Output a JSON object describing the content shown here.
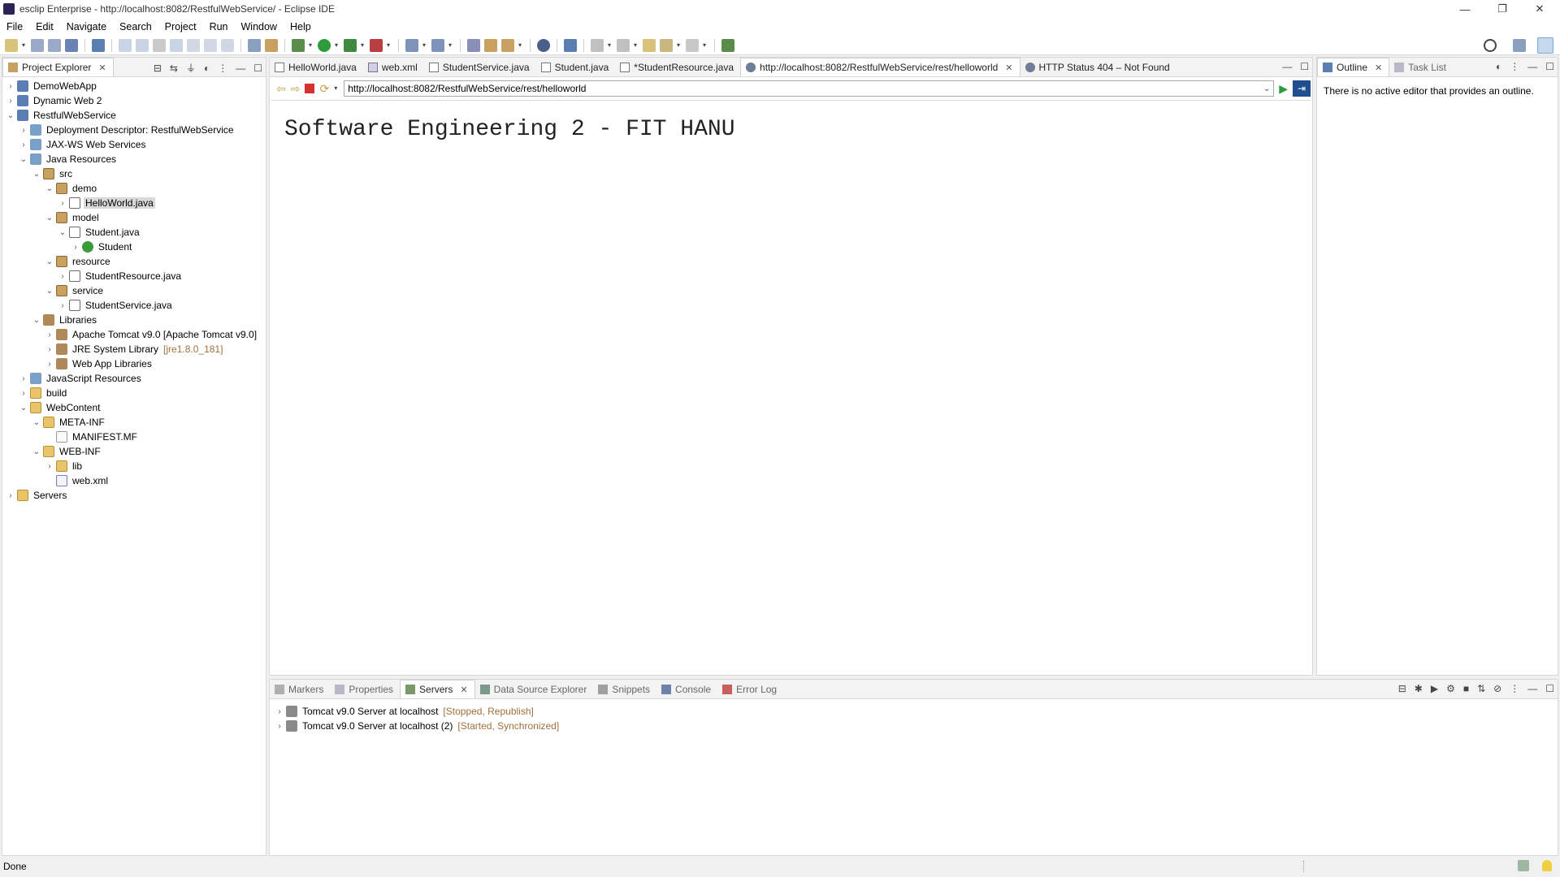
{
  "window": {
    "title": "esclip Enterprise - http://localhost:8082/RestfulWebService/ - Eclipse IDE",
    "controls": [
      "—",
      "❐",
      "✕"
    ]
  },
  "menu": [
    "File",
    "Edit",
    "Navigate",
    "Search",
    "Project",
    "Run",
    "Window",
    "Help"
  ],
  "project_explorer": {
    "tab_label": "Project Explorer",
    "tree": [
      {
        "label": "DemoWebApp",
        "depth": 0,
        "arrow": "›",
        "icon": "project"
      },
      {
        "label": "Dynamic Web 2",
        "depth": 0,
        "arrow": "›",
        "icon": "project"
      },
      {
        "label": "RestfulWebService",
        "depth": 0,
        "arrow": "⌄",
        "icon": "project"
      },
      {
        "label": "Deployment Descriptor: RestfulWebService",
        "depth": 1,
        "arrow": "›",
        "icon": "res"
      },
      {
        "label": "JAX-WS Web Services",
        "depth": 1,
        "arrow": "›",
        "icon": "res"
      },
      {
        "label": "Java Resources",
        "depth": 1,
        "arrow": "⌄",
        "icon": "res"
      },
      {
        "label": "src",
        "depth": 2,
        "arrow": "⌄",
        "icon": "pkg"
      },
      {
        "label": "demo",
        "depth": 3,
        "arrow": "⌄",
        "icon": "pkg"
      },
      {
        "label": "HelloWorld.java",
        "depth": 4,
        "arrow": "›",
        "icon": "java",
        "selected": true
      },
      {
        "label": "model",
        "depth": 3,
        "arrow": "⌄",
        "icon": "pkg"
      },
      {
        "label": "Student.java",
        "depth": 4,
        "arrow": "⌄",
        "icon": "java"
      },
      {
        "label": "Student",
        "depth": 5,
        "arrow": "›",
        "icon": "cls"
      },
      {
        "label": "resource",
        "depth": 3,
        "arrow": "⌄",
        "icon": "pkg"
      },
      {
        "label": "StudentResource.java",
        "depth": 4,
        "arrow": "›",
        "icon": "java"
      },
      {
        "label": "service",
        "depth": 3,
        "arrow": "⌄",
        "icon": "pkg"
      },
      {
        "label": "StudentService.java",
        "depth": 4,
        "arrow": "›",
        "icon": "java"
      },
      {
        "label": "Libraries",
        "depth": 2,
        "arrow": "⌄",
        "icon": "lib"
      },
      {
        "label": "Apache Tomcat v9.0 [Apache Tomcat v9.0]",
        "depth": 3,
        "arrow": "›",
        "icon": "lib"
      },
      {
        "label": "JRE System Library",
        "depth": 3,
        "arrow": "›",
        "icon": "lib",
        "deco": "[jre1.8.0_181]"
      },
      {
        "label": "Web App Libraries",
        "depth": 3,
        "arrow": "›",
        "icon": "lib"
      },
      {
        "label": "JavaScript Resources",
        "depth": 1,
        "arrow": "›",
        "icon": "res"
      },
      {
        "label": "build",
        "depth": 1,
        "arrow": "›",
        "icon": "folder"
      },
      {
        "label": "WebContent",
        "depth": 1,
        "arrow": "⌄",
        "icon": "folder"
      },
      {
        "label": "META-INF",
        "depth": 2,
        "arrow": "⌄",
        "icon": "folder"
      },
      {
        "label": "MANIFEST.MF",
        "depth": 3,
        "arrow": "",
        "icon": "file"
      },
      {
        "label": "WEB-INF",
        "depth": 2,
        "arrow": "⌄",
        "icon": "folder"
      },
      {
        "label": "lib",
        "depth": 3,
        "arrow": "›",
        "icon": "folder"
      },
      {
        "label": "web.xml",
        "depth": 3,
        "arrow": "",
        "icon": "xml"
      },
      {
        "label": "Servers",
        "depth": 0,
        "arrow": "›",
        "icon": "folder"
      }
    ]
  },
  "editor": {
    "tabs": [
      {
        "label": "HelloWorld.java",
        "icon": "java"
      },
      {
        "label": "web.xml",
        "icon": "xml"
      },
      {
        "label": "StudentService.java",
        "icon": "java"
      },
      {
        "label": "Student.java",
        "icon": "java"
      },
      {
        "label": "*StudentResource.java",
        "icon": "java"
      },
      {
        "label": "http://localhost:8082/RestfulWebService/rest/helloworld",
        "icon": "globe",
        "active": true,
        "closable": true
      },
      {
        "label": "HTTP Status 404 – Not Found",
        "icon": "globe"
      }
    ],
    "url": "http://localhost:8082/RestfulWebService/rest/helloworld",
    "page_text": "Software Engineering 2 - FIT HANU"
  },
  "outline": {
    "tabs": [
      {
        "label": "Outline",
        "active": true,
        "closable": true
      },
      {
        "label": "Task List"
      }
    ],
    "message": "There is no active editor that provides an outline."
  },
  "bottom_panel": {
    "tabs": [
      {
        "label": "Markers"
      },
      {
        "label": "Properties"
      },
      {
        "label": "Servers",
        "active": true,
        "closable": true
      },
      {
        "label": "Data Source Explorer"
      },
      {
        "label": "Snippets"
      },
      {
        "label": "Console"
      },
      {
        "label": "Error Log"
      }
    ],
    "servers": [
      {
        "name": "Tomcat v9.0 Server at localhost",
        "status": "[Stopped, Republish]"
      },
      {
        "name": "Tomcat v9.0 Server at localhost (2)",
        "status": "[Started, Synchronized]"
      }
    ]
  },
  "status": "Done",
  "colors": {
    "decoration": "#a0713b",
    "selection": "#d9d9d9"
  }
}
